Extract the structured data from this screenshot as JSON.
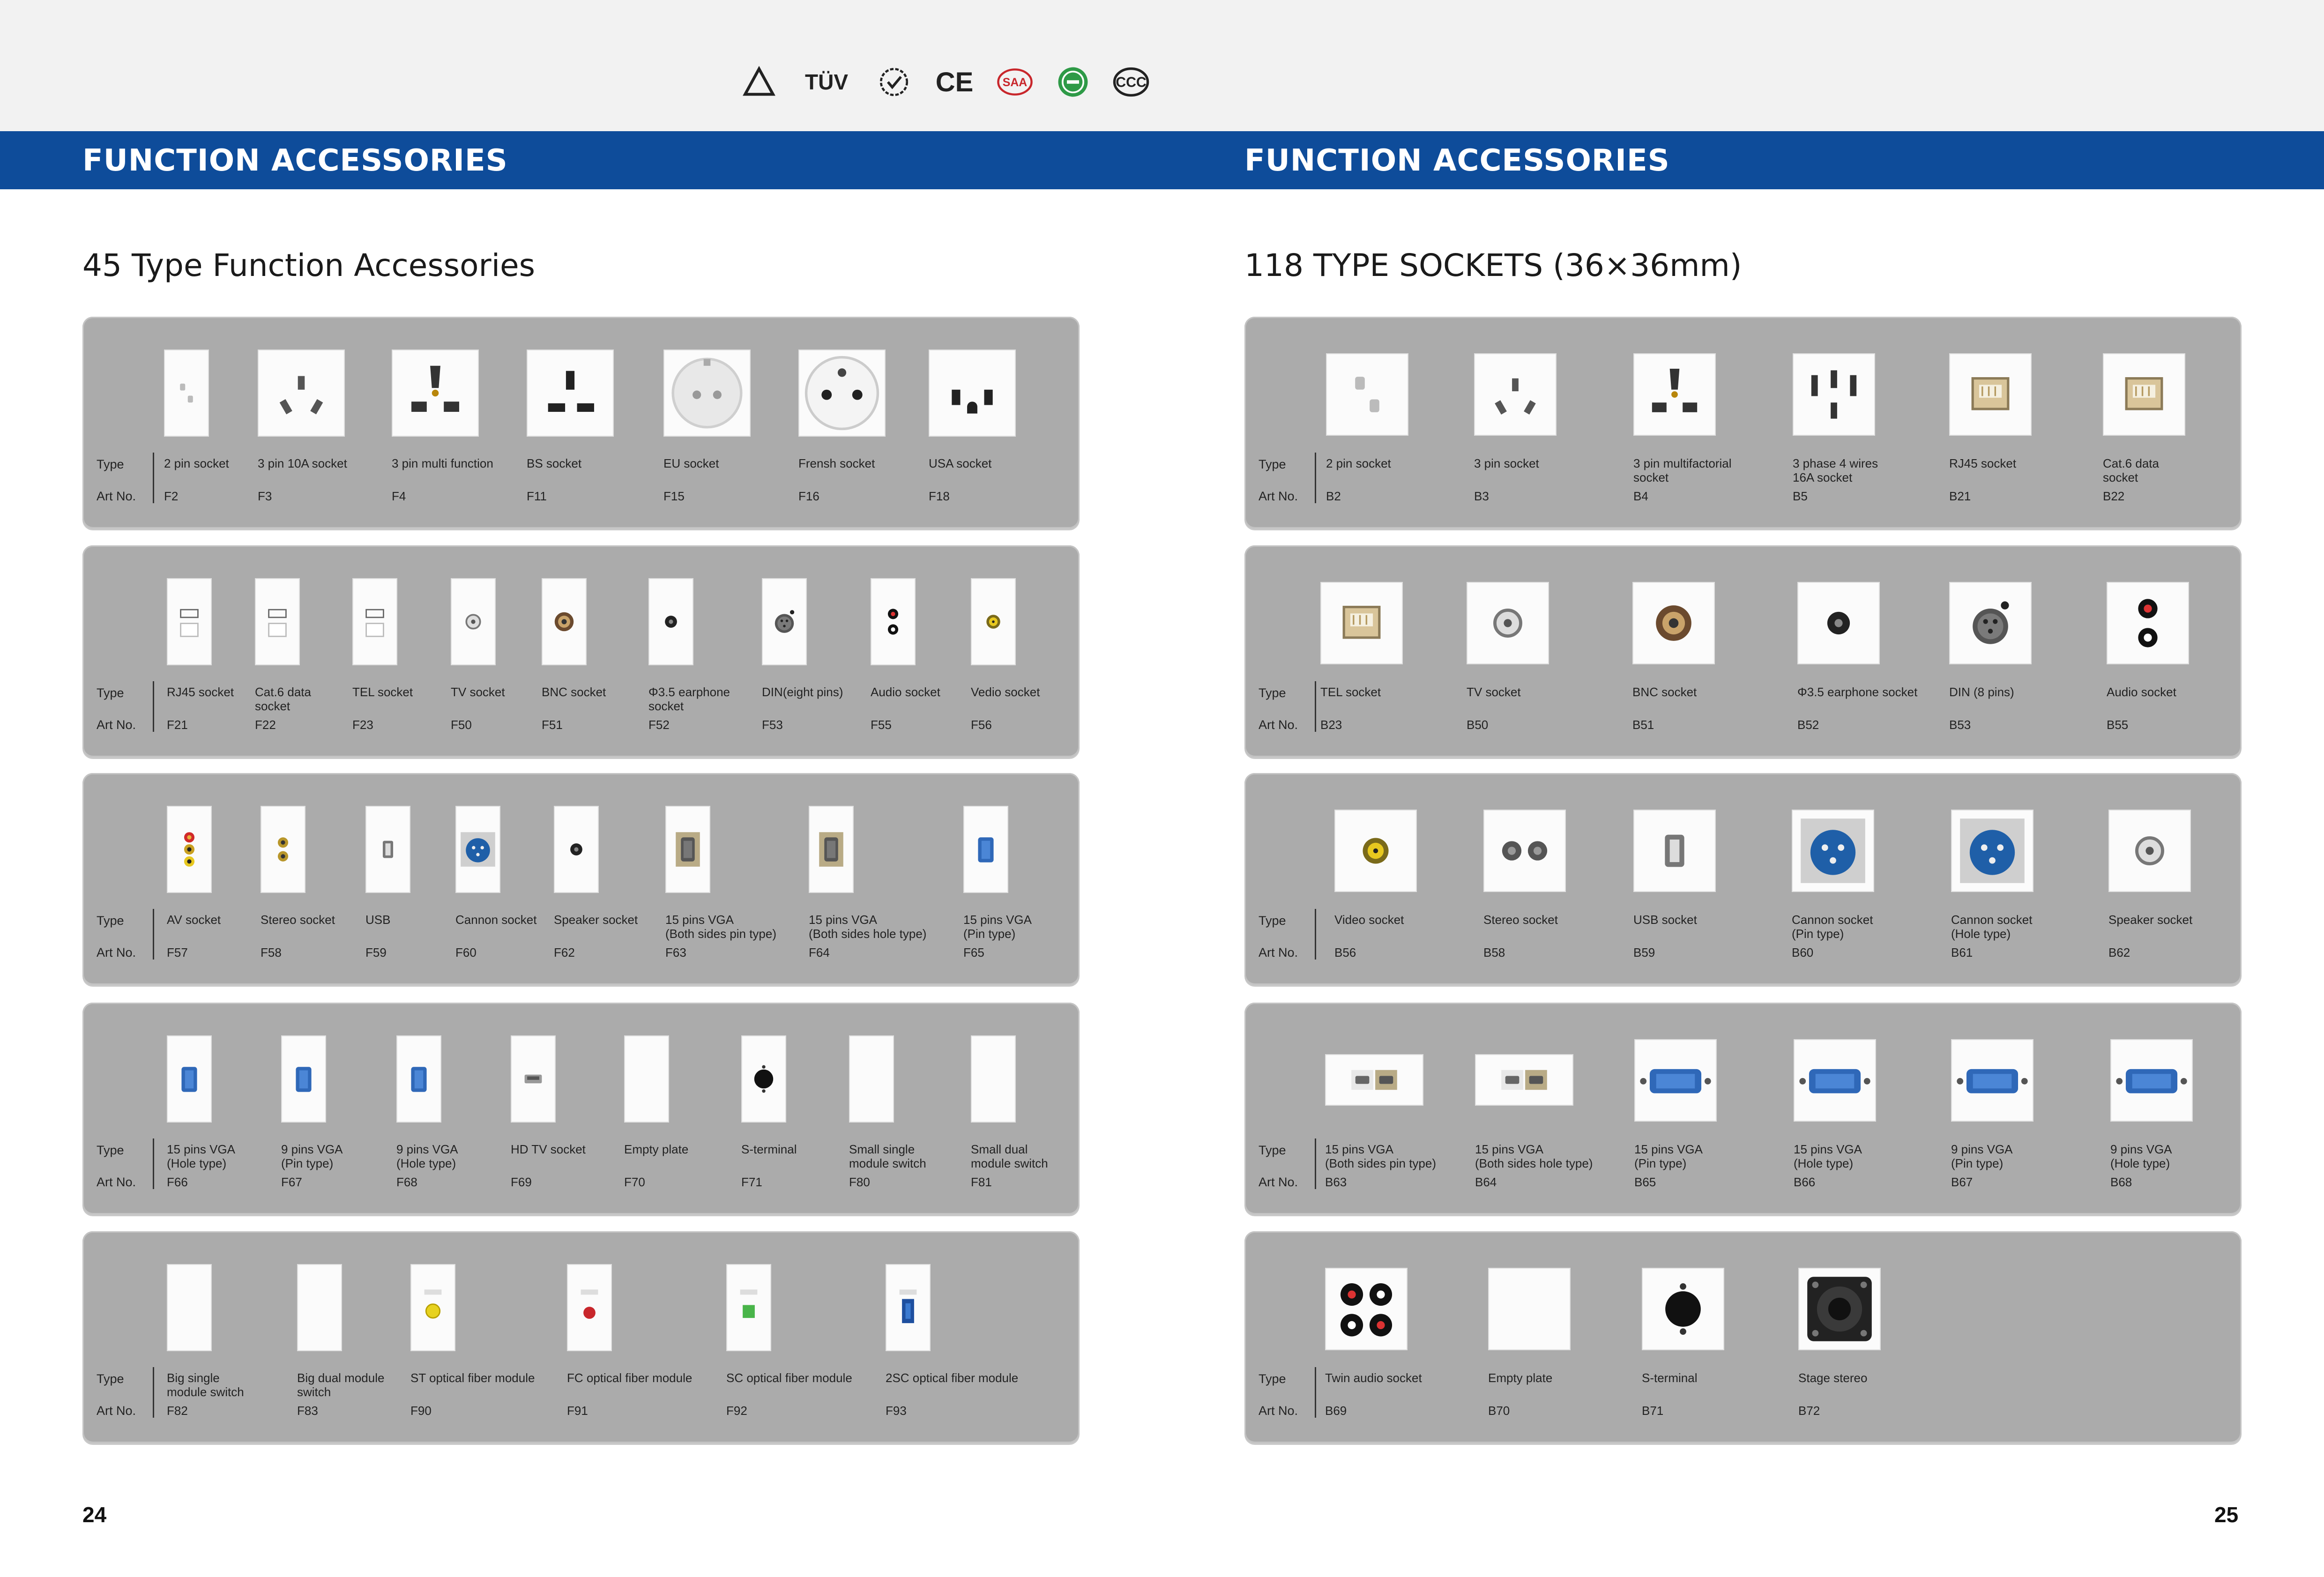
{
  "certifications": [
    "warning-triangle-icon",
    "TÜV",
    "laurel-check-icon",
    "CE",
    "SAA",
    "green-circle-mark-icon",
    "CCC"
  ],
  "left_page": {
    "banner": "FUNCTION ACCESSORIES",
    "section_title": "45 Type Function Accessories",
    "row_type_label": "Type",
    "row_art_label": "Art No.",
    "page_number": "24",
    "panels": [
      {
        "items": [
          {
            "type": "2 pin socket",
            "art": "F2",
            "icon": "2pin"
          },
          {
            "type": "3 pin 10A socket",
            "art": "F3",
            "icon": "3pin"
          },
          {
            "type": "3 pin multi function",
            "art": "F4",
            "icon": "multi"
          },
          {
            "type": "BS socket",
            "art": "F11",
            "icon": "bs"
          },
          {
            "type": "EU socket",
            "art": "F15",
            "icon": "eu"
          },
          {
            "type": "Frensh socket",
            "art": "F16",
            "icon": "fr"
          },
          {
            "type": "USA socket",
            "art": "F18",
            "icon": "usa"
          }
        ]
      },
      {
        "items": [
          {
            "type": "RJ45 socket",
            "art": "F21",
            "icon": "rj45"
          },
          {
            "type": "Cat.6 data\nsocket",
            "art": "F22",
            "icon": "rj45"
          },
          {
            "type": "TEL socket",
            "art": "F23",
            "icon": "rj45"
          },
          {
            "type": "TV socket",
            "art": "F50",
            "icon": "tv"
          },
          {
            "type": "BNC socket",
            "art": "F51",
            "icon": "bnc"
          },
          {
            "type": "Φ3.5 earphone\nsocket",
            "art": "F52",
            "icon": "jack"
          },
          {
            "type": "DIN(eight pins)",
            "art": "F53",
            "icon": "din"
          },
          {
            "type": "Audio  socket",
            "art": "F55",
            "icon": "audio2"
          },
          {
            "type": "Vedio socket",
            "art": "F56",
            "icon": "rca-yellow"
          }
        ]
      },
      {
        "items": [
          {
            "type": "AV socket",
            "art": "F57",
            "icon": "av3"
          },
          {
            "type": "Stereo socket",
            "art": "F58",
            "icon": "stereo"
          },
          {
            "type": "USB",
            "art": "F59",
            "icon": "usb"
          },
          {
            "type": "Cannon socket",
            "art": "F60",
            "icon": "xlr"
          },
          {
            "type": "Speaker socket",
            "art": "F62",
            "icon": "jack"
          },
          {
            "type": "15 pins VGA\n(Both sides pin type)",
            "art": "F63",
            "icon": "vga-gray"
          },
          {
            "type": "15 pins VGA\n(Both sides hole type)",
            "art": "F64",
            "icon": "vga-gray"
          },
          {
            "type": "15 pins VGA\n(Pin type)",
            "art": "F65",
            "icon": "vga-blue"
          }
        ]
      },
      {
        "items": [
          {
            "type": "15 pins VGA\n(Hole type)",
            "art": "F66",
            "icon": "vga-blue"
          },
          {
            "type": "9 pins VGA\n(Pin type)",
            "art": "F67",
            "icon": "vga-blue"
          },
          {
            "type": "9 pins VGA\n(Hole type)",
            "art": "F68",
            "icon": "vga-blue"
          },
          {
            "type": "HD TV socket",
            "art": "F69",
            "icon": "hdmi"
          },
          {
            "type": "Empty plate",
            "art": "F70",
            "icon": "empty"
          },
          {
            "type": "S-terminal",
            "art": "F71",
            "icon": "sterm"
          },
          {
            "type": "Small single\nmodule switch",
            "art": "F80",
            "icon": "empty"
          },
          {
            "type": "Small dual\nmodule switch",
            "art": "F81",
            "icon": "empty"
          }
        ]
      },
      {
        "items": [
          {
            "type": "Big single\nmodule switch",
            "art": "F82",
            "icon": "empty"
          },
          {
            "type": "Big dual module\nswitch",
            "art": "F83",
            "icon": "empty"
          },
          {
            "type": "ST optical fiber module",
            "art": "F90",
            "icon": "fiber-yellow"
          },
          {
            "type": "FC optical fiber module",
            "art": "F91",
            "icon": "fiber-red"
          },
          {
            "type": "SC optical fiber module",
            "art": "F92",
            "icon": "fiber-green"
          },
          {
            "type": "2SC optical fiber module",
            "art": "F93",
            "icon": "fiber-blue"
          }
        ]
      }
    ]
  },
  "right_page": {
    "banner": "FUNCTION ACCESSORIES",
    "section_title": "118 TYPE SOCKETS (36×36mm)",
    "row_type_label": "Type",
    "row_art_label": "Art No.",
    "page_number": "25",
    "panels": [
      {
        "items": [
          {
            "type": "2 pin socket",
            "art": "B2",
            "icon": "2pin"
          },
          {
            "type": "3 pin socket",
            "art": "B3",
            "icon": "3pin"
          },
          {
            "type": "3 pin multifactorial\nsocket",
            "art": "B4",
            "icon": "multi"
          },
          {
            "type": "3 phase 4 wires\n16A socket",
            "art": "B5",
            "icon": "3phase"
          },
          {
            "type": "RJ45 socket",
            "art": "B21",
            "icon": "rj45-port"
          },
          {
            "type": "Cat.6 data\nsocket",
            "art": "B22",
            "icon": "rj45-port"
          }
        ]
      },
      {
        "items": [
          {
            "type": "TEL socket",
            "art": "B23",
            "icon": "rj45-port"
          },
          {
            "type": "TV socket",
            "art": "B50",
            "icon": "tv"
          },
          {
            "type": "BNC socket",
            "art": "B51",
            "icon": "bnc"
          },
          {
            "type": "Φ3.5 earphone socket",
            "art": "B52",
            "icon": "jack"
          },
          {
            "type": "DIN (8 pins)",
            "art": "B53",
            "icon": "din"
          },
          {
            "type": "Audio socket",
            "art": "B55",
            "icon": "audio2"
          }
        ]
      },
      {
        "items": [
          {
            "type": "Video socket",
            "art": "B56",
            "icon": "rca-yellow"
          },
          {
            "type": "Stereo socket",
            "art": "B58",
            "icon": "stereo-h"
          },
          {
            "type": "USB socket",
            "art": "B59",
            "icon": "usb"
          },
          {
            "type": "Cannon socket\n(Pin type)",
            "art": "B60",
            "icon": "xlr"
          },
          {
            "type": "Cannon socket\n(Hole type)",
            "art": "B61",
            "icon": "xlr"
          },
          {
            "type": "Speaker socket",
            "art": "B62",
            "icon": "tv"
          }
        ]
      },
      {
        "items": [
          {
            "type": "15 pins VGA\n(Both sides pin type)",
            "art": "B63",
            "icon": "vga-wide"
          },
          {
            "type": "15 pins VGA\n(Both sides hole type)",
            "art": "B64",
            "icon": "vga-wide"
          },
          {
            "type": "15 pins VGA\n(Pin type)",
            "art": "B65",
            "icon": "vga-blue-h"
          },
          {
            "type": "15 pins VGA\n(Hole type)",
            "art": "B66",
            "icon": "vga-blue-h"
          },
          {
            "type": "9 pins VGA\n(Pin type)",
            "art": "B67",
            "icon": "vga-blue-h"
          },
          {
            "type": "9 pins VGA\n(Hole type)",
            "art": "B68",
            "icon": "vga-blue-h"
          }
        ]
      },
      {
        "items": [
          {
            "type": "Twin audio socket",
            "art": "B69",
            "icon": "twin-audio"
          },
          {
            "type": "Empty plate",
            "art": "B70",
            "icon": "empty"
          },
          {
            "type": "S-terminal",
            "art": "B71",
            "icon": "sterm"
          },
          {
            "type": "Stage stereo",
            "art": "B72",
            "icon": "speakon"
          }
        ]
      }
    ]
  }
}
